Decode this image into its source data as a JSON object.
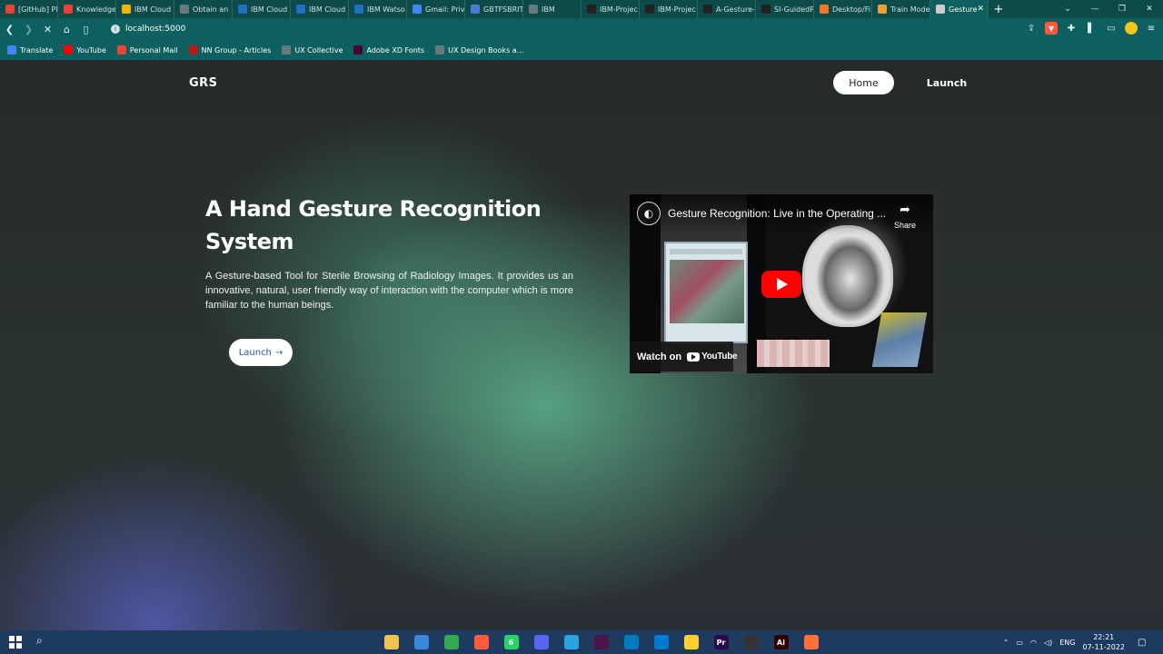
{
  "browser": {
    "tabs": [
      {
        "label": "[GitHub] Pl",
        "icon": "gmail-icon",
        "color": "#ea4335"
      },
      {
        "label": "Knowledge",
        "icon": "gmail-icon",
        "color": "#ea4335"
      },
      {
        "label": "IBM Cloud",
        "icon": "drive-icon",
        "color": "#f4b400"
      },
      {
        "label": "Obtain an",
        "icon": "globe-icon",
        "color": "#6a7a7a"
      },
      {
        "label": "IBM Cloud",
        "icon": "ibm-cloud-icon",
        "color": "#1f70c1"
      },
      {
        "label": "IBM Cloud",
        "icon": "ibm-cloud-icon",
        "color": "#1f70c1"
      },
      {
        "label": "IBM Watso",
        "icon": "ibm-watson-icon",
        "color": "#1f70c1"
      },
      {
        "label": "Gmail: Priv",
        "icon": "google-icon",
        "color": "#4285f4"
      },
      {
        "label": "GBTFSBRIT",
        "icon": "diamond-icon",
        "color": "#4a7bd0"
      },
      {
        "label": "IBM",
        "icon": "globe-icon",
        "color": "#6a7a7a"
      },
      {
        "label": "IBM-Projec",
        "icon": "github-icon",
        "color": "#222222"
      },
      {
        "label": "IBM-Projec",
        "icon": "github-icon",
        "color": "#222222"
      },
      {
        "label": "A-Gesture-",
        "icon": "github-icon",
        "color": "#222222"
      },
      {
        "label": "SI-GuidedP",
        "icon": "github-icon",
        "color": "#222222"
      },
      {
        "label": "Desktop/Fi",
        "icon": "jupyter-icon",
        "color": "#f37626"
      },
      {
        "label": "Train Mode",
        "icon": "notebook-icon",
        "color": "#f0a030"
      },
      {
        "label": "Gesture",
        "icon": "loading-icon",
        "color": "#cccccc",
        "active": true
      }
    ],
    "new_tab": "+",
    "window_controls": [
      "⌄",
      "—",
      "❐",
      "✕"
    ],
    "url": "localhost:5000",
    "bookmarks": [
      {
        "label": "Translate",
        "icon": "translate-icon",
        "color": "#4285f4"
      },
      {
        "label": "YouTube",
        "icon": "youtube-icon",
        "color": "#ff0000"
      },
      {
        "label": "Personal Mail",
        "icon": "gmail-icon",
        "color": "#ea4335"
      },
      {
        "label": "NN Group - Articles",
        "icon": "nn-group-icon",
        "color": "#b8191b"
      },
      {
        "label": "UX Collective",
        "icon": "globe-icon",
        "color": "#6a7a7a"
      },
      {
        "label": "Adobe XD Fonts",
        "icon": "adobe-xd-icon",
        "color": "#470137"
      },
      {
        "label": "UX Design Books a...",
        "icon": "globe-icon",
        "color": "#6a7a7a"
      }
    ]
  },
  "site": {
    "logo": "GRS",
    "nav": {
      "home": "Home",
      "launch": "Launch"
    },
    "hero": {
      "title": "A Hand Gesture Recognition System",
      "description": "A Gesture-based Tool for Sterile Browsing of Radiology Images. It provides us an innovative, natural, user friendly way of interaction with the computer which is more familiar to the human beings.",
      "button": "Launch"
    },
    "video": {
      "title": "Gesture Recognition: Live in the Operating ...",
      "share": "Share",
      "watch_on": "Watch on",
      "youtube": "YouTube"
    }
  },
  "taskbar": {
    "apps": [
      {
        "icon": "file-explorer-icon",
        "color": "#f2c14e",
        "label": ""
      },
      {
        "icon": "download-icon",
        "color": "#3a86d8",
        "label": ""
      },
      {
        "icon": "chrome-icon",
        "color": "#34a853",
        "label": ""
      },
      {
        "icon": "brave-icon",
        "color": "#ff5a3c",
        "label": ""
      },
      {
        "icon": "whatsapp-icon",
        "color": "#25d366",
        "label": "6"
      },
      {
        "icon": "discord-icon",
        "color": "#5865f2",
        "label": ""
      },
      {
        "icon": "telegram-icon",
        "color": "#2aa3e0",
        "label": ""
      },
      {
        "icon": "slack-icon",
        "color": "#4a154b",
        "label": ""
      },
      {
        "icon": "trello-icon",
        "color": "#0079bf",
        "label": ""
      },
      {
        "icon": "vscode-icon",
        "color": "#007acc",
        "label": ""
      },
      {
        "icon": "miro-icon",
        "color": "#ffd02f",
        "label": ""
      },
      {
        "icon": "premiere-icon",
        "color": "#2a0a4a",
        "label": "Pr"
      },
      {
        "icon": "figma-icon",
        "color": "#333333",
        "label": ""
      },
      {
        "icon": "illustrator-icon",
        "color": "#330000",
        "label": "Ai"
      },
      {
        "icon": "firefox-icon",
        "color": "#ff7139",
        "label": ""
      }
    ],
    "language": "ENG",
    "time": "22:21",
    "date": "07-11-2022"
  }
}
